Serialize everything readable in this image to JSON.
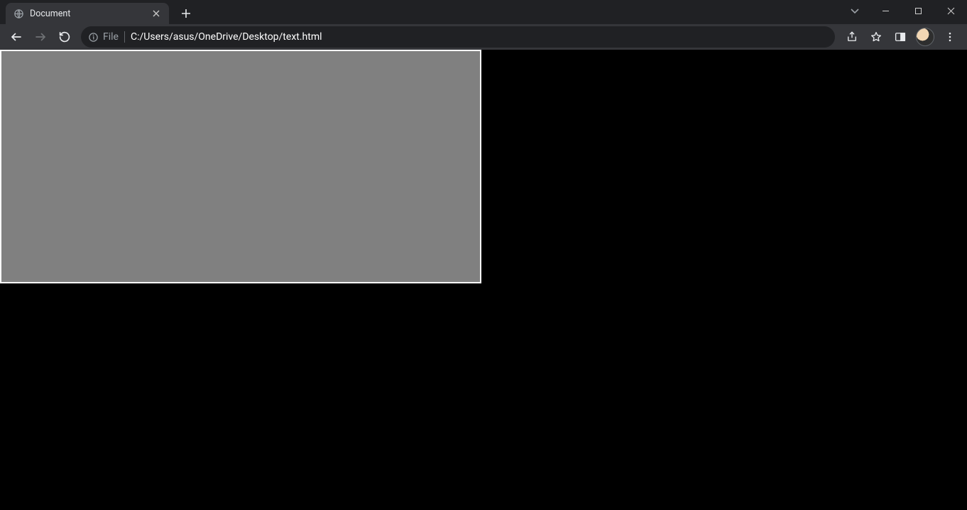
{
  "tab": {
    "title": "Document"
  },
  "address": {
    "scheme_label": "File",
    "path": "C:/Users/asus/OneDrive/Desktop/text.html"
  },
  "icons": {
    "globe": "globe-icon",
    "close": "close-icon",
    "plus": "plus-icon",
    "chevron_down": "chevron-down-icon",
    "minimize": "minimize-icon",
    "maximize": "maximize-icon",
    "window_close": "window-close-icon",
    "back": "back-arrow-icon",
    "forward": "forward-arrow-icon",
    "reload": "reload-icon",
    "info": "info-icon",
    "share": "share-icon",
    "star": "star-icon",
    "sidepanel": "side-panel-icon",
    "menu": "menu-dots-icon"
  },
  "page": {
    "background": "#000000",
    "box": {
      "fill": "#808080",
      "border": "#ffffff"
    }
  }
}
